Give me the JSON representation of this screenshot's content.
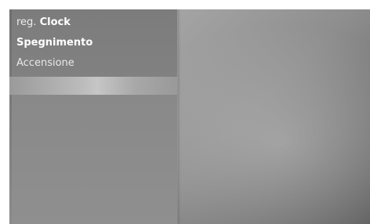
{
  "menu": {
    "items": [
      {
        "label_prefix": "reg.",
        "label_main": "Clock"
      },
      {
        "label": "Spegnimento"
      },
      {
        "label": "Accensione"
      }
    ],
    "selected_index": 3
  }
}
